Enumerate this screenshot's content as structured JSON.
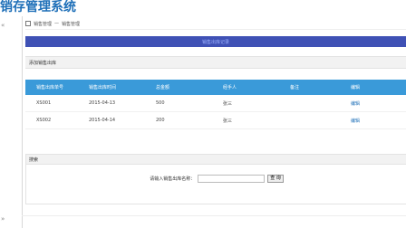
{
  "app": {
    "title": "销存管理系统",
    "left_marker": "«",
    "left_marker_bottom": "»"
  },
  "breadcrumb": {
    "items": [
      "销售管理",
      "—",
      "销售管理"
    ]
  },
  "banner": {
    "text": "销售出库记录"
  },
  "toolbar": {
    "add_label": "添加销售出库"
  },
  "table": {
    "headers": [
      "销售出库单号",
      "销售出库时间",
      "总金额",
      "经手人",
      "备注",
      "编辑"
    ],
    "rows": [
      {
        "id": "XS001",
        "date": "2015-04-13",
        "amount": "500",
        "handler": "张三",
        "note": "",
        "action": "编辑"
      },
      {
        "id": "XS002",
        "date": "2015-04-14",
        "amount": "200",
        "handler": "张三",
        "note": "",
        "action": "编辑"
      }
    ]
  },
  "search": {
    "header": "搜索",
    "label": "请输入销售出库名称：",
    "input_value": "",
    "button_label": "查 询"
  }
}
